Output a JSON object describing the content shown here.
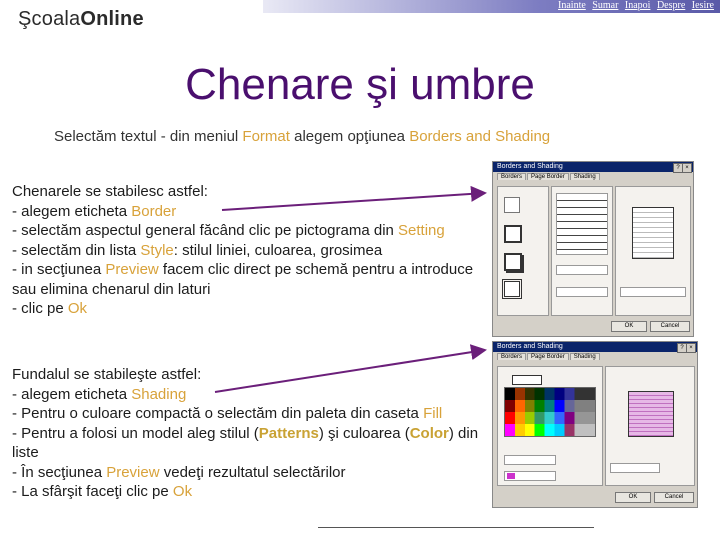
{
  "nav": [
    "Inainte",
    "Sumar",
    "Inapoi",
    "Despre",
    "Iesire"
  ],
  "logo": {
    "part1": "Şcoala",
    "part2": "Online"
  },
  "title": "Chenare şi umbre",
  "intro": {
    "t1": "Selectăm textul -  din meniul ",
    "format": "Format",
    "t2": " alegem opţiunea ",
    "borders": "Borders and Shading"
  },
  "block1": {
    "l1a": "Chenarele se stabilesc astfel:",
    "l2a": "- alegem eticheta ",
    "l2b": "Border",
    "l3a": "- selectăm aspectul general făcând clic pe pictograma din ",
    "l3b": "Setting",
    "l4a": "- selectăm din lista ",
    "l4b": "Style",
    "l4c": ": stilul liniei, culoarea, grosimea",
    "l5a": "- in secţiunea ",
    "l5b": "Preview",
    "l5c": " facem clic direct pe schemă pentru a introduce sau elimina chenarul din laturi",
    "l6a": "-  clic pe ",
    "l6b": "Ok"
  },
  "block2": {
    "l1a": "Fundalul se stabileşte astfel:",
    "l2a": "- alegem eticheta ",
    "l2b": "Shading",
    "l3a": "- Pentru o culoare compactă o selectăm din paleta din caseta ",
    "l3b": "Fill",
    "l4a": "- Pentru a folosi un model aleg stilul (",
    "l4b": "Patterns",
    "l4c": ") şi culoarea (",
    "l4d": "Color",
    "l4e": ") din liste",
    "l5a": "- În secţiunea ",
    "l5b": "Preview",
    "l5c": " vedeţi rezultatul selectărilor",
    "l6a": "- La sfârşit faceţi clic pe ",
    "l6b": "Ok"
  },
  "dialog1": {
    "caption": "Borders and Shading",
    "tabs": [
      "Borders",
      "Page Border",
      "Shading"
    ],
    "ok": "OK",
    "cancel": "Cancel"
  },
  "dialog2": {
    "caption": "Borders and Shading",
    "tabs": [
      "Borders",
      "Page Border",
      "Shading"
    ],
    "ok": "OK",
    "cancel": "Cancel"
  },
  "colors": {
    "title": "#4a0f6e",
    "highlight": "#d8a23a",
    "arrow": "#6b1f7a",
    "topbar": "#7d7dc2"
  }
}
